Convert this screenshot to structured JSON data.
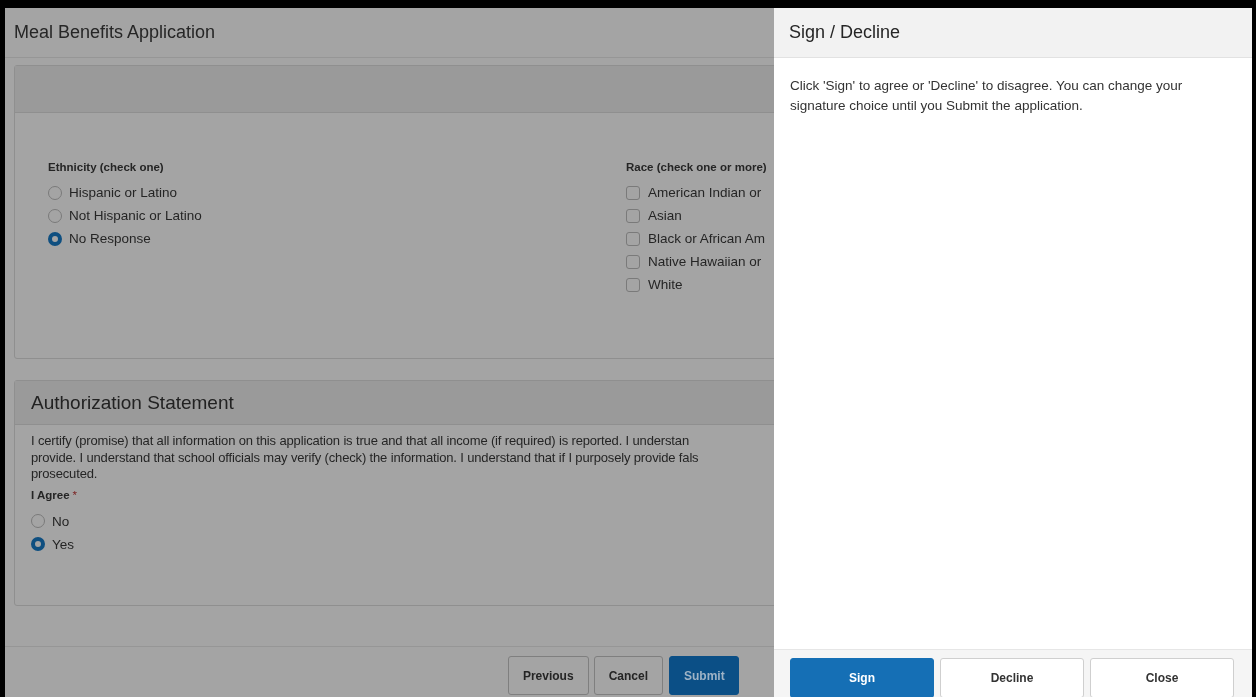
{
  "page": {
    "title": "Meal Benefits Application"
  },
  "demographics": {
    "ethnicity": {
      "label": "Ethnicity (check one)",
      "options": [
        {
          "label": "Hispanic or Latino",
          "selected": false
        },
        {
          "label": "Not Hispanic or Latino",
          "selected": false
        },
        {
          "label": "No Response",
          "selected": true
        }
      ]
    },
    "race": {
      "label": "Race (check one or more)",
      "options": [
        {
          "label": "American Indian or",
          "checked": false
        },
        {
          "label": "Asian",
          "checked": false
        },
        {
          "label": "Black or African Am",
          "checked": false
        },
        {
          "label": "Native Hawaiian or",
          "checked": false
        },
        {
          "label": "White",
          "checked": false
        }
      ]
    }
  },
  "authorization": {
    "title": "Authorization Statement",
    "statement_lines": [
      "I certify (promise) that all information on this application is true and that all income (if required) is reported. I understan",
      "provide. I understand that school officials may verify (check) the information. I understand that if I purposely provide fals",
      "prosecuted."
    ],
    "agree_label": "I Agree",
    "required_mark": "*",
    "options": [
      {
        "label": "No",
        "selected": false
      },
      {
        "label": "Yes",
        "selected": true
      }
    ]
  },
  "footer_buttons": [
    {
      "label": "Previous",
      "kind": "secondary"
    },
    {
      "label": "Cancel",
      "kind": "secondary"
    },
    {
      "label": "Submit",
      "kind": "primary"
    }
  ],
  "panel": {
    "title": "Sign / Decline",
    "message": "Click 'Sign' to agree or 'Decline' to disagree. You can change your signature choice until you Submit the application.",
    "buttons": [
      {
        "label": "Sign",
        "kind": "primary"
      },
      {
        "label": "Decline",
        "kind": "secondary"
      },
      {
        "label": "Close",
        "kind": "secondary"
      }
    ]
  }
}
